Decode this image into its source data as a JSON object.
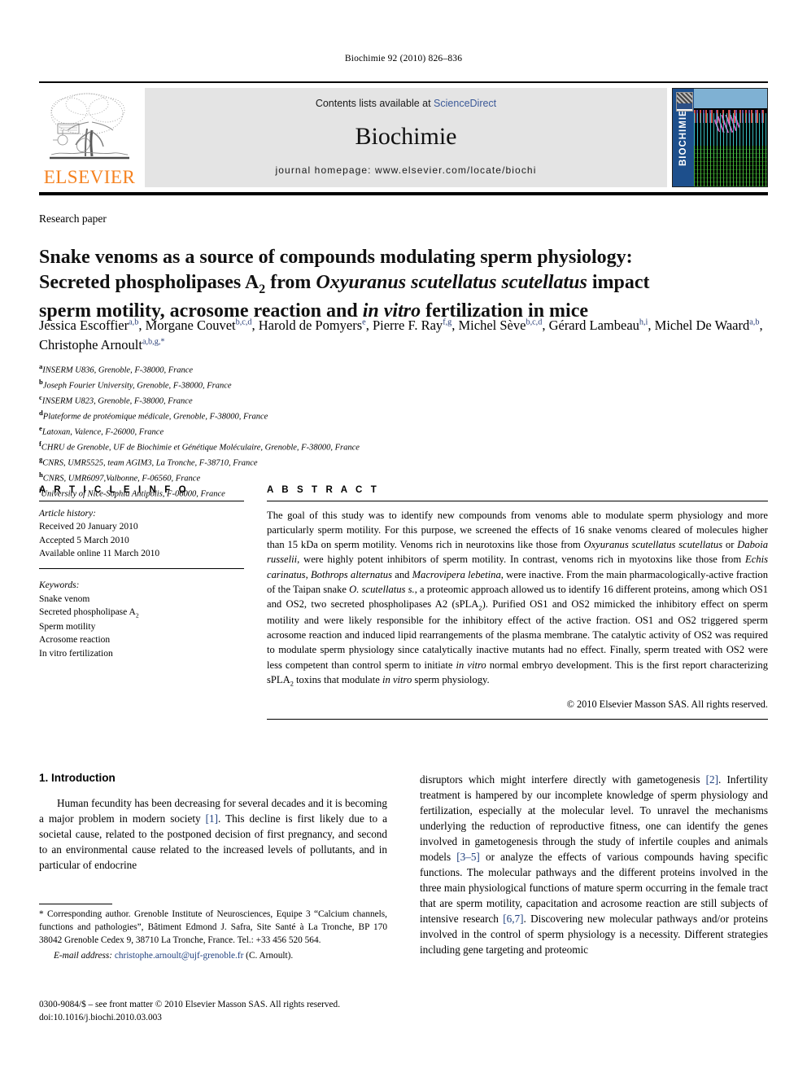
{
  "running_head": "Biochimie 92 (2010) 826–836",
  "masthead": {
    "contents_prefix": "Contents lists available at ",
    "sciencedirect": "ScienceDirect",
    "journal_title": "Biochimie",
    "homepage": "journal homepage: www.elsevier.com/locate/biochi",
    "publisher_logo_text": "ELSEVIER",
    "cover_spine_text": "BIOCHIMIE",
    "sciencedirect_color": "#3b5998",
    "elsevier_orange": "#F58220",
    "cover_blue": "#1d4f8c"
  },
  "article": {
    "type": "Research paper",
    "title_line1": "Snake venoms as a source of compounds modulating sperm physiology:",
    "title_line2_a": "Secreted phospholipases A",
    "title_line2_sub": "2",
    "title_line2_b": " from ",
    "title_line2_italic": "Oxyuranus scutellatus scutellatus",
    "title_line2_c": " impact",
    "title_line3_a": "sperm motility, acrosome reaction and ",
    "title_line3_italic": "in vitro",
    "title_line3_b": " fertilization in mice"
  },
  "authors": [
    {
      "name": "Jessica Escoffier",
      "sup": "a,b",
      "sep": ", "
    },
    {
      "name": "Morgane Couvet",
      "sup": "b,c,d",
      "sep": ", "
    },
    {
      "name": "Harold de Pomyers",
      "sup": "e",
      "sep": ", "
    },
    {
      "name": "Pierre F. Ray",
      "sup": "f,g",
      "sep": ", "
    },
    {
      "name": "Michel Sève",
      "sup": "b,c,d",
      "sep": ", "
    },
    {
      "name": "Gérard Lambeau",
      "sup": "h,i",
      "sep": ", "
    },
    {
      "name": "Michel De Waard",
      "sup": "a,b",
      "sep": ", "
    },
    {
      "name": "Christophe Arnoult",
      "sup": "a,b,g,*",
      "sep": ""
    }
  ],
  "affiliations": [
    {
      "mark": "a",
      "text": "INSERM U836, Grenoble, F-38000, France"
    },
    {
      "mark": "b",
      "text": "Joseph Fourier University, Grenoble, F-38000, France"
    },
    {
      "mark": "c",
      "text": "INSERM U823, Grenoble, F-38000, France"
    },
    {
      "mark": "d",
      "text": "Plateforme de protéomique médicale, Grenoble, F-38000, France"
    },
    {
      "mark": "e",
      "text": "Latoxan, Valence, F-26000, France"
    },
    {
      "mark": "f",
      "text": "CHRU de Grenoble, UF de Biochimie et Génétique Moléculaire, Grenoble, F-38000, France"
    },
    {
      "mark": "g",
      "text": "CNRS, UMR5525, team AGIM3, La Tronche, F-38710, France"
    },
    {
      "mark": "h",
      "text": "CNRS, UMR6097,Valbonne, F-06560, France"
    },
    {
      "mark": "i",
      "text": "University of Nice-Sophia Antipolis, F-06000, France"
    }
  ],
  "article_info": {
    "heading": "A R T I C L E   I N F O",
    "history_label": "Article history:",
    "history": [
      "Received 20 January 2010",
      "Accepted 5 March 2010",
      "Available online 11 March 2010"
    ],
    "keywords_label": "Keywords:",
    "keywords": [
      "Snake venom",
      "Secreted phospholipase A2",
      "Sperm motility",
      "Acrosome reaction",
      "In vitro fertilization"
    ]
  },
  "abstract": {
    "heading": "A B S T R A C T",
    "paragraph": "The goal of this study was to identify new compounds from venoms able to modulate sperm physiology and more particularly sperm motility. For this purpose, we screened the effects of 16 snake venoms cleared of molecules higher than 15 kDa on sperm motility. Venoms rich in neurotoxins like those from Oxyuranus scutellatus scutellatus or Daboia russelii, were highly potent inhibitors of sperm motility. In contrast, venoms rich in myotoxins like those from Echis carinatus, Bothrops alternatus and Macrovipera lebetina, were inactive. From the main pharmacologically-active fraction of the Taipan snake O. scutellatus s., a proteomic approach allowed us to identify 16 different proteins, among which OS1 and OS2, two secreted phospholipases A2 (sPLA2). Purified OS1 and OS2 mimicked the inhibitory effect on sperm motility and were likely responsible for the inhibitory effect of the active fraction. OS1 and OS2 triggered sperm acrosome reaction and induced lipid rearrangements of the plasma membrane. The catalytic activity of OS2 was required to modulate sperm physiology since catalytically inactive mutants had no effect. Finally, sperm treated with OS2 were less competent than control sperm to initiate in vitro normal embryo development. This is the first report characterizing sPLA2 toxins that modulate in vitro sperm physiology.",
    "copyright": "© 2010 Elsevier Masson SAS. All rights reserved."
  },
  "introduction": {
    "heading": "1.  Introduction",
    "left_paragraph": "Human fecundity has been decreasing for several decades and it is becoming a major problem in modern society [1]. This decline is first likely due to a societal cause, related to the postponed decision of first pregnancy, and second to an environmental cause related to the increased levels of pollutants, and in particular of endocrine",
    "right_paragraph": "disruptors which might interfere directly with gametogenesis [2]. Infertility treatment is hampered by our incomplete knowledge of sperm physiology and fertilization, especially at the molecular level. To unravel the mechanisms underlying the reduction of reproductive fitness, one can identify the genes involved in gametogenesis through the study of infertile couples and animals models [3–5] or analyze the effects of various compounds having specific functions. The molecular pathways and the different proteins involved in the three main physiological functions of mature sperm occurring in the female tract that are sperm motility, capacitation and acrosome reaction are still subjects of intensive research [6,7]. Discovering new molecular pathways and/or proteins involved in the control of sperm physiology is a necessity. Different strategies including gene targeting and proteomic"
  },
  "footnotes": {
    "corresponding": "* Corresponding author. Grenoble Institute of Neurosciences, Equipe 3 “Calcium channels, functions and pathologies”, Bâtiment Edmond J. Safra, Site Santé à La Tronche, BP 170 38042 Grenoble Cedex 9, 38710 La Tronche, France. Tel.: +33 456 520 564.",
    "email_label": "E-mail address:",
    "email": "christophe.arnoult@ujf-grenoble.fr",
    "email_suffix": " (C. Arnoult).",
    "issn_line": "0300-9084/$ – see front matter © 2010 Elsevier Masson SAS. All rights reserved.",
    "doi_line": "doi:10.1016/j.biochi.2010.03.003"
  }
}
